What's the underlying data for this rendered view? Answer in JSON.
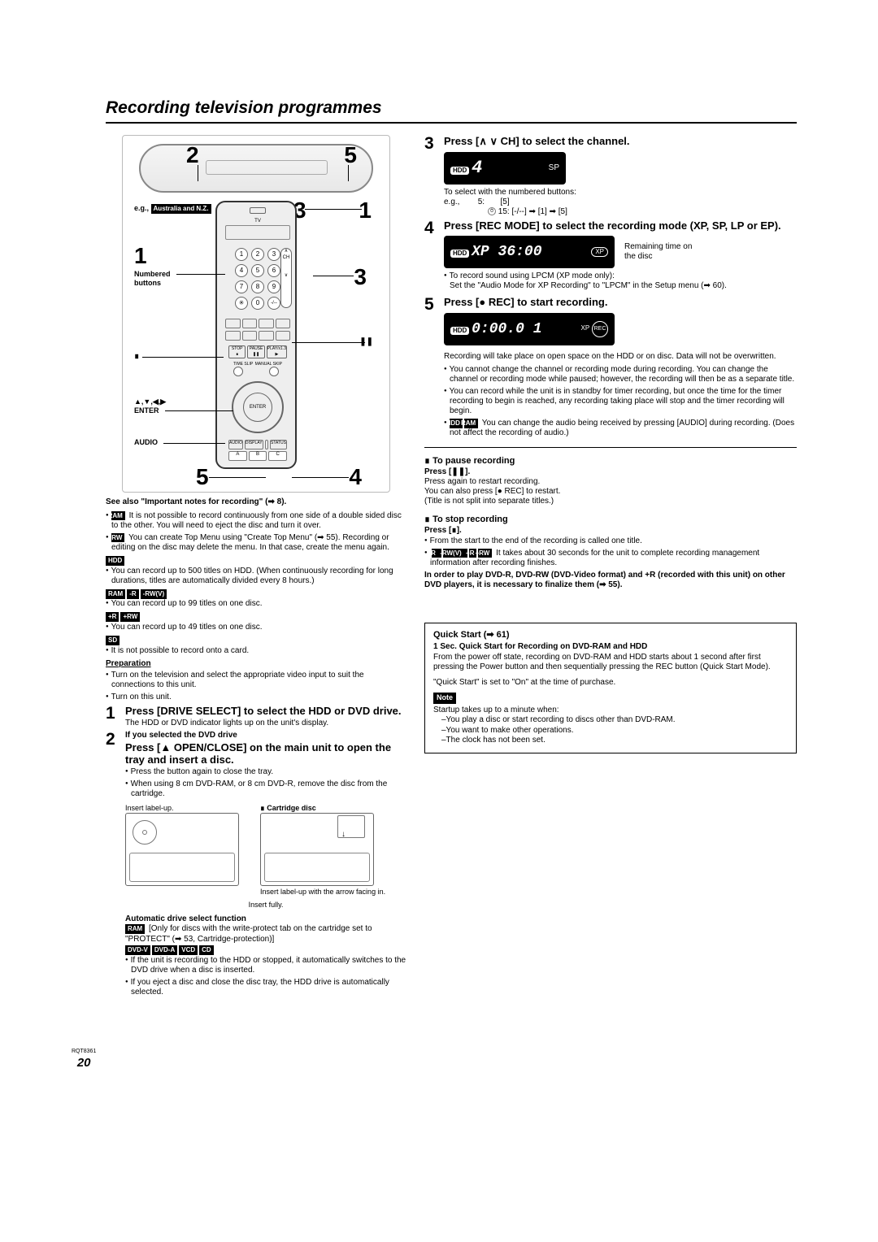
{
  "title": "Recording television programmes",
  "fig": {
    "top2": "2",
    "top5": "5",
    "mid1a": "1",
    "mid3": "3",
    "mid1b": "1",
    "inner3": "3",
    "bot5": "5",
    "bot4": "4",
    "eg": "e.g.,",
    "region": "Australia and N.Z.",
    "numbered": "Numbered",
    "buttons": "buttons",
    "arrows": "▲,▼,◀,▶",
    "enter": "ENTER",
    "audio": "AUDIO",
    "enter_btn": "ENTER",
    "num0": "0",
    "n1": "1",
    "n2": "2",
    "n3": "3",
    "n4": "4",
    "n5": "5",
    "n6": "6",
    "n7": "7",
    "n8": "8",
    "n9": "9"
  },
  "see_also": "See also \"Important notes for recording\" (➡ 8).",
  "notes_left": {
    "ram": "RAM",
    "ram_txt": "It is not possible to record continuously from one side of a double sided disc to the other. You will need to eject the disc and turn it over.",
    "plusrw": "+RW",
    "plusrw_txt": "You can create Top Menu using \"Create Top Menu\" (➡ 55). Recording or editing on the disc may delete the menu. In that case, create the menu again.",
    "hdd": "HDD",
    "hdd_txt": "You can record up to 500 titles on HDD. (When continuously recording for long durations, titles are automatically divided every 8 hours.)",
    "ram2": "RAM",
    "minr": "-R",
    "rwv": "-RW(V)",
    "ram2_txt": "You can record up to 99 titles on one disc.",
    "plusr": "+R",
    "plusrw2": "+RW",
    "plusr_txt": "You can record up to 49 titles on one disc.",
    "sd": "SD",
    "sd_txt": "It is not possible to record onto a card.",
    "prep": "Preparation",
    "prep1": "Turn on the television and select the appropriate video input to suit the connections to this unit.",
    "prep2": "Turn on this unit."
  },
  "step1": {
    "num": "1",
    "title": "Press [DRIVE SELECT] to select the HDD or DVD drive.",
    "sub": "The HDD or DVD indicator lights up on the unit's display."
  },
  "step2": {
    "num": "2",
    "pre": "If you selected the DVD drive",
    "title": "Press [▲ OPEN/CLOSE] on the main unit to open the tray and insert a disc.",
    "b1": "Press the button again to close the tray.",
    "b2": "When using 8 cm DVD-RAM, or 8 cm DVD-R, remove the disc from the cartridge.",
    "insert_label": "Insert label-up.",
    "cartridge": "∎ Cartridge disc",
    "insert_label2": "Insert label-up with the arrow facing in.",
    "insert_fully": "Insert fully.",
    "auto_head": "Automatic drive select function",
    "auto1a": "RAM",
    "auto1": "[Only for discs with the write-protect tab on the cartridge set to \"PROTECT\" (➡ 53, Cartridge-protection)]",
    "auto_tags": [
      "DVD-V",
      "DVD-A",
      "VCD",
      "CD"
    ],
    "auto2": "If the unit is recording to the HDD or stopped, it automatically switches to the DVD drive when a disc is inserted.",
    "auto3": "If you eject a disc and close the disc tray, the HDD drive is automatically selected."
  },
  "step3": {
    "num": "3",
    "title": "Press [∧ ∨ CH] to select the channel.",
    "hdd": "HDD",
    "sp": "SP",
    "ch": "4",
    "sel_txt": "To select with the numbered buttons:",
    "eg": "e.g.,",
    "l1": "5:       [5]",
    "l2": "15:     [-/--] ➡ [1] ➡ [5]"
  },
  "step4": {
    "num": "4",
    "title": "Press [REC MODE] to select the recording mode (XP, SP, LP or EP).",
    "hdd": "HDD",
    "xp": "XP",
    "time_txt": "Remaining time on the disc",
    "b1": "To record sound using LPCM (XP mode only):",
    "b1b": "Set the \"Audio Mode for XP Recording\" to \"LPCM\" in the Setup menu (➡ 60)."
  },
  "step5": {
    "num": "5",
    "title": "Press [● REC] to start recording.",
    "hdd": "HDD",
    "xp": "XP",
    "rec": "REC",
    "intro": "Recording will take place on open space on the HDD or on disc. Data will not be overwritten.",
    "b1": "You cannot change the channel or recording mode during recording. You can change the channel or recording mode while paused; however, the recording will then be as a separate title.",
    "b2": "You can record while the unit is in standby for timer recording, but once the time for the timer recording to begin is reached, any recording taking place will stop and the timer recording will begin.",
    "b3a": "HDD",
    "b3b": "RAM",
    "b3": "You can change the audio being received by pressing [AUDIO] during recording. (Does not affect the recording of audio.)"
  },
  "pause": {
    "head": "To pause recording",
    "press": "Press [❚❚].",
    "l1": "Press again to restart recording.",
    "l2": "You can also press [● REC] to restart.",
    "l3": "(Title is not split into separate titles.)"
  },
  "stop": {
    "head": "To stop recording",
    "press": "Press [∎].",
    "b1": "From the start to the end of the recording is called one title.",
    "b2tags": [
      "-R",
      "-RW(V)",
      "+R",
      "+RW"
    ],
    "b2": "It takes about 30 seconds for the unit to complete recording management information after recording finishes.",
    "bold": "In order to play DVD-R, DVD-RW (DVD-Video format) and +R (recorded with this unit) on other DVD players, it is necessary to finalize them (➡ 55)."
  },
  "quick": {
    "title": "Quick Start (➡ 61)",
    "sub": "1 Sec. Quick Start for Recording on DVD-RAM and HDD",
    "p1": "From the power off state, recording on DVD-RAM and HDD starts about 1 second after first pressing the Power button and then sequentially pressing the REC button (Quick Start Mode).",
    "p2": "\"Quick Start\" is set to \"On\" at the time of purchase.",
    "note": "Note",
    "p3": "Startup takes up to a minute when:",
    "b1": "–You play a disc or start recording to discs other than DVD-RAM.",
    "b2": "–You want to make other operations.",
    "b3": "–The clock has not been set."
  },
  "footer": {
    "rqt": "RQT8361",
    "page": "20"
  }
}
